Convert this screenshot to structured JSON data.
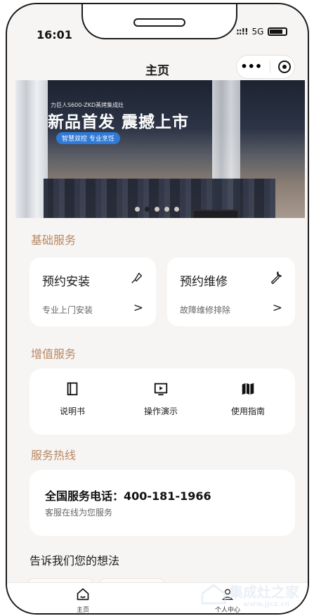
{
  "status_bar": {
    "time": "16:01",
    "network": "5G",
    "signal": "::!!"
  },
  "nav": {
    "title": "主页",
    "menu_icon": "more-dots-icon",
    "close_icon": "target-icon"
  },
  "banner": {
    "small_text": "力巨人S600-ZKD蒸烤集成灶",
    "headline": "新品首发 震撼上市",
    "tag": "智慧双控 专业烹饪",
    "indicator_count": 5,
    "active_index": 1
  },
  "basic_services": {
    "title": "基础服务",
    "cards": [
      {
        "title": "预约安装",
        "subtitle": "专业上门安装",
        "arrow": ">",
        "icon": "screwdriver-icon"
      },
      {
        "title": "预约维修",
        "subtitle": "故障维修排除",
        "arrow": ">",
        "icon": "wrench-icon"
      }
    ]
  },
  "value_added": {
    "title": "增值服务",
    "items": [
      {
        "label": "说明书",
        "icon": "book-icon"
      },
      {
        "label": "操作演示",
        "icon": "play-icon"
      },
      {
        "label": "使用指南",
        "icon": "map-icon"
      }
    ]
  },
  "hotline": {
    "title": "服务热线",
    "phone": "全国服务电话：400-181-1966",
    "sub": "客服在线为您服务"
  },
  "feedback": {
    "title": "告诉我们您的想法"
  },
  "tabbar": {
    "items": [
      {
        "label": "主页",
        "icon": "home-icon"
      },
      {
        "label": "个人中心",
        "icon": "user-icon"
      }
    ]
  },
  "watermark": {
    "text": "集成灶之家",
    "url": "www.jjcz.cn"
  },
  "colors": {
    "accent": "#b88762",
    "page_bg": "#f7f5f3",
    "card_bg": "#ffffff"
  }
}
